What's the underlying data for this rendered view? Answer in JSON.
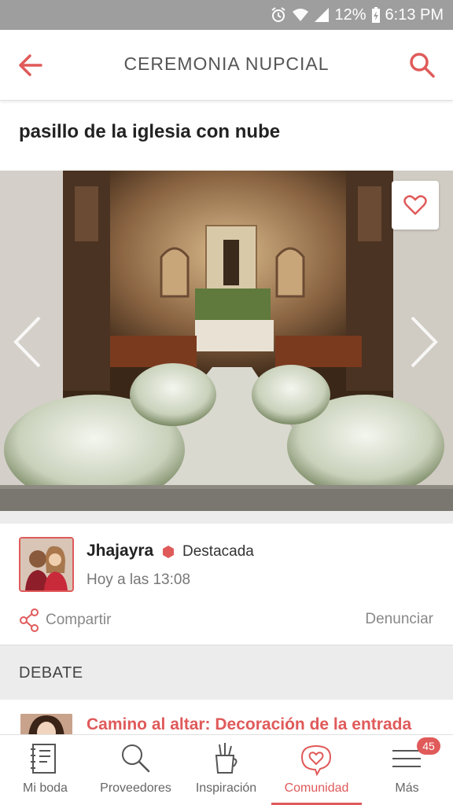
{
  "status_bar": {
    "battery": "12%",
    "time": "6:13 PM",
    "icons": [
      "alarm-icon",
      "wifi-icon",
      "signal-icon",
      "battery-charging-icon"
    ]
  },
  "app_bar": {
    "title": "CEREMONIA NUPCIAL",
    "back_icon": "arrow-left-icon",
    "search_icon": "search-icon"
  },
  "post": {
    "title": "pasillo de la iglesia con nube",
    "photo_icons": [
      "heart-outline-icon",
      "chevron-left-icon",
      "chevron-right-icon"
    ]
  },
  "author": {
    "name": "Jhajayra",
    "badge": "Destacada",
    "time": "Hoy a las 13:08"
  },
  "actions": {
    "share": "Compartir",
    "report": "Denunciar"
  },
  "debate": {
    "label": "DEBATE",
    "related_title": "Camino al altar: Decoración de la entrada"
  },
  "bottom_nav": {
    "items": [
      {
        "label": "Mi boda",
        "icon": "notebook-icon"
      },
      {
        "label": "Proveedores",
        "icon": "search-icon"
      },
      {
        "label": "Inspiración",
        "icon": "pencil-cup-icon"
      },
      {
        "label": "Comunidad",
        "icon": "heart-chat-icon",
        "active": true
      },
      {
        "label": "Más",
        "icon": "menu-icon"
      }
    ],
    "badge": "45"
  },
  "colors": {
    "accent": "#e05a5a",
    "status_bar": "#9e9e9e",
    "section_bg": "#ececec"
  }
}
